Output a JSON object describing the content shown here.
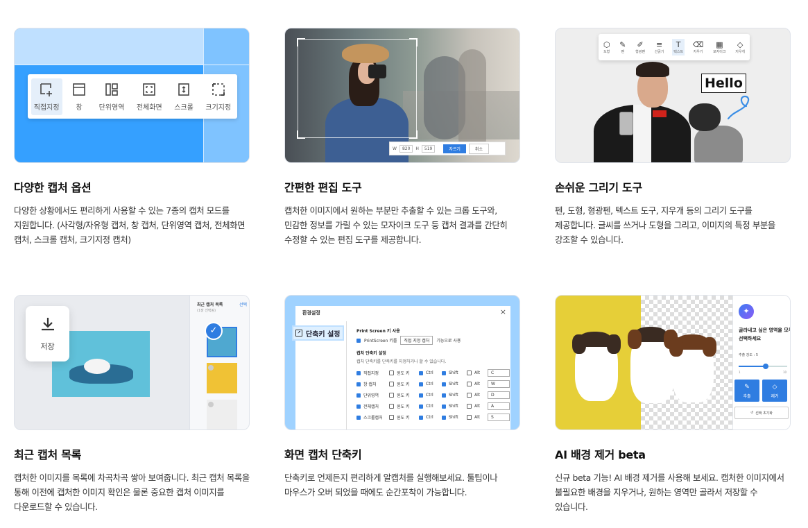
{
  "cards": [
    {
      "title": "다양한 캡처 옵션",
      "desc": "다양한 상황에서도 편리하게 사용할 수 있는 7종의 캡처 모드를 지원합니다. (사각형/자유형 캡처, 창 캡처, 단위영역 캡처, 전체화면 캡처, 스크롤 캡처, 크기지정 캡처)",
      "modes": [
        "직접지정",
        "창",
        "단위영역",
        "전체화면",
        "스크롤",
        "크기지정"
      ]
    },
    {
      "title": "간편한 편집 도구",
      "desc": "캡처한 이미지에서 원하는 부분만 추출할 수 있는 크롭 도구와, 민감한 정보를 가릴 수 있는 모자이크 도구 등 캡처 결과를 간단히 수정할 수 있는 편집 도구를 제공합니다.",
      "crop": {
        "w_label": "W",
        "w": "820",
        "h_label": "H",
        "h": "519",
        "ok": "자르기",
        "cancel": "취소"
      }
    },
    {
      "title": "손쉬운 그리기 도구",
      "desc": "펜, 도형, 형광펜, 텍스트 도구, 지우개 등의 그리기 도구를 제공합니다. 글씨를 쓰거나 도형을 그리고, 이미지의 특정 부분을 강조할 수 있습니다.",
      "tools": [
        "도형",
        "펜",
        "형광펜",
        "선굵기",
        "텍스트",
        "지우기",
        "모자이크",
        "지우개"
      ],
      "hello": "Hello"
    },
    {
      "title": "최근 캡처 목록",
      "desc": "캡처한 이미지를 목록에 차곡차곡 쌓아 보여줍니다. 최근 캡처 목록을 통해 이전에 캡처한 이미지 확인은 물론 중요한 캡처 이미지를 다운로드할 수 있습니다.",
      "save": "저장",
      "recent_title": "최근 캡처 목록",
      "recent_sub": "(1장 선택됨)",
      "recent_select": "선택"
    },
    {
      "title": "화면 캡처 단축키",
      "desc": "단축키로 언제든지 편리하게 알캡처를 실행해보세요. 툴팁이나 마우스가 오버 되었을 때에도 순간포착이 가능합니다.",
      "dialog_title": "환경설정",
      "shortcut_tag": "단축키 설정",
      "ps_section": "Print Screen 키 사용",
      "ps_line_a": "PrintScreen 키를",
      "ps_select": "직접 지정 캡처",
      "ps_line_b": "기능으로 사용",
      "key_section": "캡처 단축키 설정",
      "key_note": "캡처 단축키를 단축키를 지정하거나 할 수 있습니다.",
      "rows": [
        {
          "name": "직접지정",
          "key": "C"
        },
        {
          "name": "창 캡처",
          "key": "W"
        },
        {
          "name": "단위영역",
          "key": "D"
        },
        {
          "name": "전체캡처",
          "key": "A"
        },
        {
          "name": "스크롤캡처",
          "key": "S"
        }
      ],
      "mods": {
        "win": "윈도 키",
        "ctrl": "Ctrl",
        "shift": "Shift",
        "alt": "Alt"
      }
    },
    {
      "title": "AI 배경 제거 beta",
      "desc": "신규 beta 기능! AI 배경 제거를 사용해 보세요. 캡처한 이미지에서 불필요한 배경을 지우거나, 원하는 영역만 골라서 저장할 수 있습니다.",
      "question": "골라내고 싶은 영역을 모두 선택하세요",
      "level_label": "추출 강도 : 5",
      "slider_min": "1",
      "slider_max": "10",
      "btn_extract": "추출",
      "btn_remove": "제거",
      "btn_reset": "선택 초기화"
    }
  ]
}
